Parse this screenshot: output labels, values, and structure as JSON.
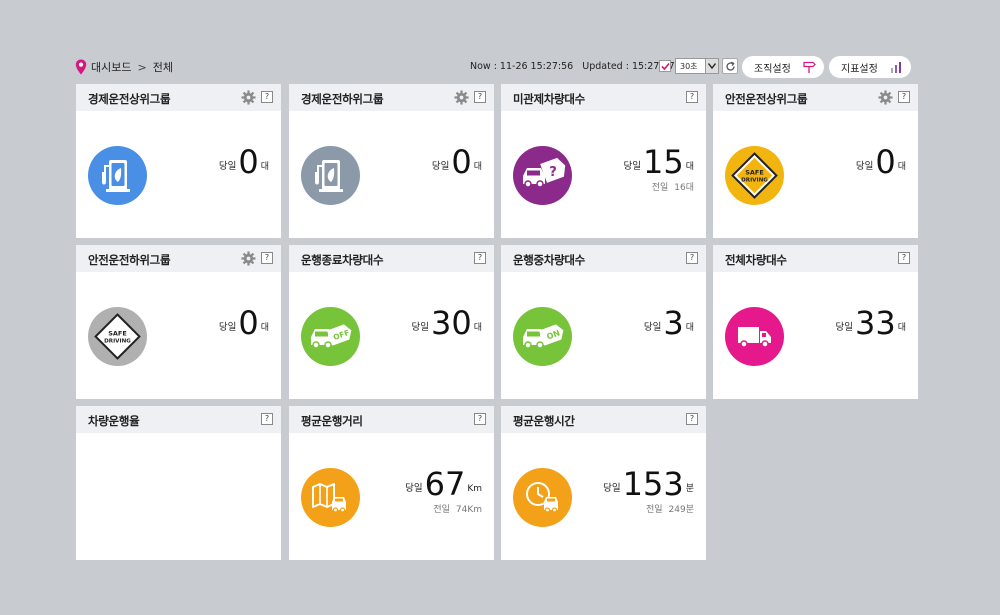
{
  "breadcrumb": {
    "root": "대시보드",
    "separator": ">",
    "current": "전체"
  },
  "status": {
    "now": "Now : 11-26 15:27:56",
    "updated": "Updated : 15:27:37"
  },
  "refresh_select": {
    "value": "30초"
  },
  "buttons": {
    "org_settings": "조직설정",
    "kpi_settings": "지표설정"
  },
  "colors": {
    "blue": "#4a8fe6",
    "gray": "#8b99a8",
    "purple": "#8c2a8c",
    "yellow": "#f2b40f",
    "light_gray": "#b0b0b0",
    "green": "#77c43a",
    "magenta": "#e5198c",
    "orange": "#f4a11a"
  },
  "cards": [
    {
      "title": "경제운전상위그룹",
      "prefix": "당일",
      "value": "0",
      "unit": "대",
      "icon": "fuel-pump-leaf-icon"
    },
    {
      "title": "경제운전하위그룹",
      "prefix": "당일",
      "value": "0",
      "unit": "대",
      "icon": "fuel-pump-leaf-icon"
    },
    {
      "title": "미관제차량대수",
      "prefix": "당일",
      "value": "15",
      "unit": "대",
      "prev_label": "전일",
      "prev_value": "16대",
      "icon": "car-question-icon"
    },
    {
      "title": "안전운전상위그룹",
      "prefix": "당일",
      "value": "0",
      "unit": "대",
      "icon": "safe-driving-sign-icon",
      "sign_text": [
        "SAFE",
        "DRIVING"
      ]
    },
    {
      "title": "안전운전하위그룹",
      "prefix": "당일",
      "value": "0",
      "unit": "대",
      "icon": "safe-driving-sign-icon",
      "sign_text": [
        "SAFE",
        "DRIVING"
      ]
    },
    {
      "title": "운행종료차량대수",
      "prefix": "당일",
      "value": "30",
      "unit": "대",
      "icon": "car-off-icon",
      "tag": "OFF"
    },
    {
      "title": "운행중차량대수",
      "prefix": "당일",
      "value": "3",
      "unit": "대",
      "icon": "car-on-icon",
      "tag": "ON"
    },
    {
      "title": "전체차량대수",
      "prefix": "당일",
      "value": "33",
      "unit": "대",
      "icon": "truck-icon"
    },
    {
      "title": "차량운행율"
    },
    {
      "title": "평균운행거리",
      "prefix": "당일",
      "value": "67",
      "unit": "Km",
      "prev_label": "전일",
      "prev_value": "74Km",
      "icon": "map-car-icon"
    },
    {
      "title": "평균운행시간",
      "prefix": "당일",
      "value": "153",
      "unit": "분",
      "prev_label": "전일",
      "prev_value": "249분",
      "icon": "clock-car-icon"
    }
  ],
  "help_label": "?"
}
